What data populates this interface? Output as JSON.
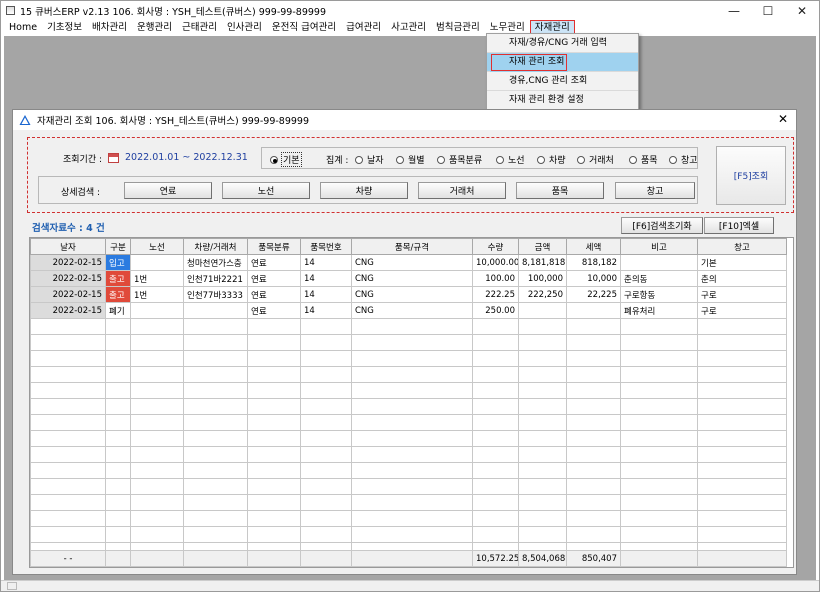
{
  "window": {
    "title": "15 큐버스ERP v2.13  106. 회사명 : YSH_테스트(큐버스)  999-99-89999",
    "min_glyph": "—",
    "max_glyph": "☐",
    "close_glyph": "✕"
  },
  "menu": [
    "Home",
    "기초정보",
    "배차관리",
    "운행관리",
    "근태관리",
    "인사관리",
    "운전직 급여관리",
    "급여관리",
    "사고관리",
    "범칙금관리",
    "노무관리",
    "자재관리"
  ],
  "dropdown": [
    "자재/경유/CNG 거래 입력",
    "자재 관리 조회",
    "경유,CNG 관리 조회",
    "자재 관리 환경 설정"
  ],
  "child": {
    "title": "자재관리 조회 106. 회사명 : YSH_테스트(큐버스)  999-99-89999",
    "close_glyph": "✕",
    "period_label": "조회기간 :",
    "date_range": "2022.01.01 ~ 2022.12.31",
    "agg_label": "집계 :",
    "radios": [
      "기본",
      "날자",
      "월별",
      "품목분류",
      "노선",
      "차량",
      "거래처",
      "품목",
      "창고"
    ],
    "detail_label": "상세검색 :",
    "detail_buttons": [
      "연료",
      "노선",
      "차량",
      "거래처",
      "품목",
      "창고"
    ],
    "search_button": "[F5]조회",
    "result_count": "검색자료수 : 4 건",
    "reset_button": "[F6]검색초기화",
    "excel_button": "[F10]엑셀"
  },
  "table": {
    "columns": [
      "날자",
      "구분",
      "노선",
      "차량/거래처",
      "품목분류",
      "품목번호",
      "품목/규격",
      "수량",
      "금액",
      "세액",
      "비고",
      "창고"
    ],
    "rows": [
      [
        "2022-02-15",
        "입고",
        "",
        "청마천연가스충",
        "연료",
        "14",
        "CNG",
        "10,000.00",
        "8,181,818",
        "818,182",
        "",
        "기본"
      ],
      [
        "2022-02-15",
        "출고",
        "1번",
        "인천71바2221",
        "연료",
        "14",
        "CNG",
        "100.00",
        "100,000",
        "10,000",
        "춘의동",
        "춘의"
      ],
      [
        "2022-02-15",
        "출고",
        "1번",
        "인천77바3333",
        "연료",
        "14",
        "CNG",
        "222.25",
        "222,250",
        "22,225",
        "구로항동",
        "구로"
      ],
      [
        "2022-02-15",
        "폐기",
        "",
        "",
        "연료",
        "14",
        "CNG",
        "250.00",
        "",
        "",
        "폐유처리",
        "구로"
      ]
    ],
    "totals": [
      "- -",
      "",
      "",
      "",
      "",
      "",
      "",
      "10,572.25",
      "8,504,068",
      "850,407",
      "",
      ""
    ]
  },
  "colors": {
    "in": "#2b7be0",
    "out": "#e04a3a",
    "date": "#1f3fa0",
    "count": "#1f5fb0"
  }
}
